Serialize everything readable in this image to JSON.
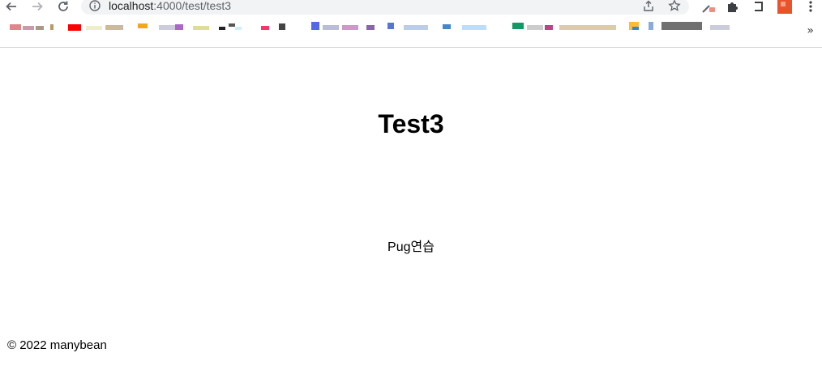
{
  "browser": {
    "url_host": "localhost",
    "url_path": ":4000/test/test3",
    "bookmarks_more": "»"
  },
  "page": {
    "title": "Test3",
    "text": "Pug연습",
    "footer": "© 2022 manybean"
  }
}
